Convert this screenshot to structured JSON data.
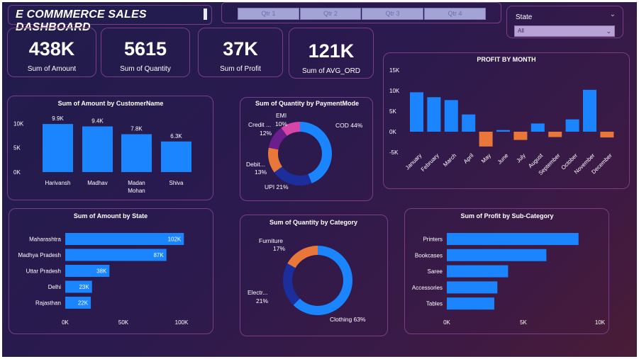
{
  "header": {
    "title": "E COMMMERCE SALES DASHBOARD"
  },
  "quarter_slicer": {
    "options": [
      "Qtr 1",
      "Qtr 2",
      "Qtr 3",
      "Qtr 4"
    ]
  },
  "state_slicer": {
    "label": "State",
    "selected": "All"
  },
  "kpis": [
    {
      "value": "438K",
      "label": "Sum of Amount"
    },
    {
      "value": "5615",
      "label": "Sum of Quantity"
    },
    {
      "value": "37K",
      "label": "Sum of Profit"
    },
    {
      "value": "121K",
      "label": "Sum of AVG_ORD"
    }
  ],
  "colors": {
    "blue": "#1a85ff",
    "navy": "#1b2e9c",
    "orange": "#e9773a",
    "purple": "#6b1f8c",
    "pink": "#d645a8",
    "border": "#7a3d86"
  },
  "chart_data": [
    {
      "type": "bar",
      "title": "Sum of Amount by CustomerName",
      "categories": [
        "Harivansh",
        "Madhav",
        "Madan Mohan",
        "Shiva"
      ],
      "values": [
        9.9,
        9.4,
        7.8,
        6.3
      ],
      "data_labels": [
        "9.9K",
        "9.4K",
        "7.8K",
        "6.3K"
      ],
      "yticks": [
        {
          "v": 0,
          "label": "0K"
        },
        {
          "v": 5,
          "label": "5K"
        },
        {
          "v": 10,
          "label": "10K"
        }
      ],
      "ylim": [
        0,
        10.5
      ],
      "grid": false
    },
    {
      "type": "pie",
      "title": "Sum of Quantity by PaymentMode",
      "slices": [
        {
          "label": "COD",
          "pct": 44,
          "text": "COD 44%"
        },
        {
          "label": "UPI",
          "pct": 21,
          "text": "UPI 21%"
        },
        {
          "label": "Debit ...",
          "pct": 13,
          "text1": "Debit...",
          "text2": "13%"
        },
        {
          "label": "Credit ...",
          "pct": 12,
          "text1": "Credit ...",
          "text2": "12%"
        },
        {
          "label": "EMI",
          "pct": 10,
          "text1": "EMI",
          "text2": "10%"
        }
      ]
    },
    {
      "type": "bar",
      "title": "PROFIT BY MONTH",
      "categories": [
        "January",
        "February",
        "March",
        "April",
        "May",
        "June",
        "July",
        "August",
        "September",
        "October",
        "November",
        "December"
      ],
      "values": [
        9.6,
        8.4,
        7.7,
        4.2,
        -3.6,
        0.4,
        -2.0,
        2.0,
        -1.3,
        3.0,
        10.2,
        -1.4
      ],
      "yticks": [
        {
          "v": -5,
          "label": "-5K"
        },
        {
          "v": 0,
          "label": "0K"
        },
        {
          "v": 5,
          "label": "5K"
        },
        {
          "v": 10,
          "label": "10K"
        },
        {
          "v": 15,
          "label": "15K"
        }
      ],
      "ylim": [
        -5,
        15
      ],
      "grid": false
    },
    {
      "type": "bar",
      "orientation": "horizontal",
      "title": "Sum of Amount by State",
      "categories": [
        "Maharashtra",
        "Madhya Pradesh",
        "Uttar Pradesh",
        "Delhi",
        "Rajasthan"
      ],
      "values": [
        102,
        87,
        38,
        23,
        22
      ],
      "data_labels": [
        "102K",
        "87K",
        "38K",
        "23K",
        "22K"
      ],
      "xticks": [
        {
          "v": 0,
          "label": "0K"
        },
        {
          "v": 50,
          "label": "50K"
        },
        {
          "v": 100,
          "label": "100K"
        }
      ],
      "xlim": [
        0,
        100
      ]
    },
    {
      "type": "pie",
      "title": "Sum of Quantity by Category",
      "slices": [
        {
          "label": "Clothing",
          "pct": 63,
          "text": "Clothing 63%"
        },
        {
          "label": "Electr...",
          "pct": 21,
          "text1": "Electr...",
          "text2": "21%"
        },
        {
          "label": "Furniture",
          "pct": 17,
          "text1": "Furniture",
          "text2": "17%"
        }
      ]
    },
    {
      "type": "bar",
      "orientation": "horizontal",
      "title": "Sum of Profit by Sub-Category",
      "categories": [
        "Printers",
        "Bookcases",
        "Saree",
        "Accessories",
        "Tables"
      ],
      "values": [
        8.6,
        6.5,
        4.0,
        3.3,
        3.1
      ],
      "xticks": [
        {
          "v": 0,
          "label": "0K"
        },
        {
          "v": 5,
          "label": "5K"
        },
        {
          "v": 10,
          "label": "10K"
        }
      ],
      "xlim": [
        0,
        10
      ]
    }
  ]
}
